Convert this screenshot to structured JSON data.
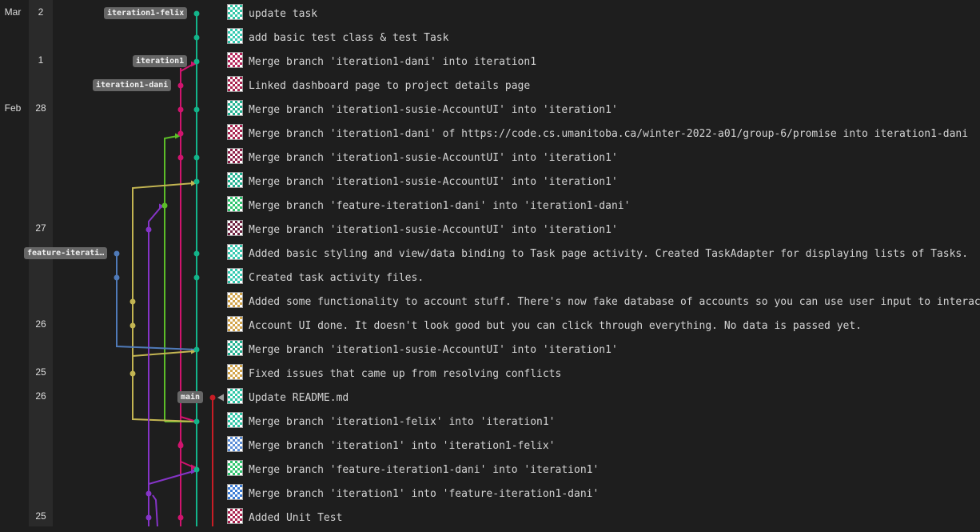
{
  "months": [
    {
      "label": "Mar",
      "row": 0
    },
    {
      "label": "Feb",
      "row": 4
    }
  ],
  "day_labels": [
    {
      "label": "2",
      "row": 0
    },
    {
      "label": "1",
      "row": 2
    },
    {
      "label": "28",
      "row": 4
    },
    {
      "label": "27",
      "row": 9
    },
    {
      "label": "26",
      "row": 13
    },
    {
      "label": "25",
      "row": 15
    },
    {
      "label": "26",
      "row": 16
    },
    {
      "label": "25",
      "row": 21
    }
  ],
  "ref_labels": [
    {
      "label": "iteration1-felix",
      "row": 0
    },
    {
      "label": "iteration1",
      "row": 2
    },
    {
      "label": "iteration1-dani",
      "row": 3
    },
    {
      "label": "feature-iterati…",
      "row": 10
    },
    {
      "label": "main",
      "row": 16
    }
  ],
  "lane_colors": {
    "teal": "#13b48a",
    "magenta": "#d0146e",
    "green": "#5cbd28",
    "olive": "#c3b552",
    "purple": "#8534c7",
    "blue": "#4f7ab8",
    "red": "#c81d25"
  },
  "commits": [
    {
      "message": "update task",
      "avatar": "#2fc6a6"
    },
    {
      "message": "add basic test class & test Task",
      "avatar": "#35c9b0"
    },
    {
      "message": "Merge branch 'iteration1-dani' into iteration1",
      "avatar": "#b5245a"
    },
    {
      "message": "Linked dashboard page to project details page",
      "avatar": "#a8234f"
    },
    {
      "message": "Merge branch 'iteration1-susie-AccountUI' into 'iteration1'",
      "avatar": "#1fb08f"
    },
    {
      "message": "Merge branch 'iteration1-dani' of https://code.cs.umanitoba.ca/winter-2022-a01/group-6/promise into iteration1-dani",
      "avatar": "#a8234f"
    },
    {
      "message": "Merge branch 'iteration1-susie-AccountUI' into 'iteration1'",
      "avatar": "#8b2048"
    },
    {
      "message": "Merge branch 'iteration1-susie-AccountUI' into 'iteration1'",
      "avatar": "#1fb08f"
    },
    {
      "message": "Merge branch 'feature-iteration1-dani' into 'iteration1-dani'",
      "avatar": "#2ec46e"
    },
    {
      "message": "Merge branch 'iteration1-susie-AccountUI' into 'iteration1'",
      "avatar": "#6b1f3d"
    },
    {
      "message": "Added basic styling and view/data binding to Task page activity. Created TaskAdapter for displaying lists of Tasks.",
      "avatar": "#35c9b0"
    },
    {
      "message": "Created task activity files.",
      "avatar": "#35c9b0"
    },
    {
      "message": "Added some functionality to account stuff. There's now fake database of accounts so you can use user input to interact",
      "avatar": "#d2a44a"
    },
    {
      "message": "Account UI done. It doesn't look good but you can click through everything. No data is passed yet.",
      "avatar": "#d2a44a"
    },
    {
      "message": "Merge branch 'iteration1-susie-AccountUI' into 'iteration1'",
      "avatar": "#1fb08f"
    },
    {
      "message": "Fixed issues that came up from resolving conflicts",
      "avatar": "#d2a44a"
    },
    {
      "message": "Update README.md",
      "avatar": "#2fc6a6"
    },
    {
      "message": "Merge branch 'iteration1-felix' into 'iteration1'",
      "avatar": "#2fc6a6"
    },
    {
      "message": "Merge branch 'iteration1' into 'iteration1-felix'",
      "avatar": "#5a8cd6"
    },
    {
      "message": "Merge branch 'feature-iteration1-dani' into 'iteration1'",
      "avatar": "#2ec46e"
    },
    {
      "message": "Merge branch 'iteration1' into 'feature-iteration1-dani'",
      "avatar": "#3a7bd5"
    },
    {
      "message": "Added Unit Test",
      "avatar": "#a8234f"
    }
  ]
}
